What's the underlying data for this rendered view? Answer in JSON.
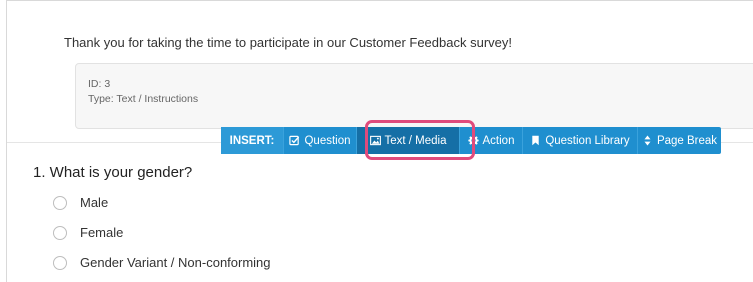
{
  "survey": {
    "intro_text": "Thank you for taking the time to participate in our Customer Feedback survey!"
  },
  "info_box": {
    "id_line": "ID: 3",
    "type_line": "Type: Text / Instructions"
  },
  "toolbar": {
    "insert_label": "INSERT:",
    "items": [
      {
        "label": "Question",
        "icon": "checkbox-icon"
      },
      {
        "label": "Text / Media",
        "icon": "image-icon"
      },
      {
        "label": "Action",
        "icon": "gear-icon"
      },
      {
        "label": "Question Library",
        "icon": "bookmark-icon"
      },
      {
        "label": "Page Break",
        "icon": "sort-arrows-icon"
      }
    ],
    "highlighted_item": "Text / Media",
    "colors": {
      "bar": "#1f8fcf",
      "active": "#156fa6",
      "highlight": "#e04b7c"
    }
  },
  "question": {
    "title": "1. What is your gender?",
    "options": [
      "Male",
      "Female",
      "Gender Variant / Non-conforming"
    ]
  }
}
